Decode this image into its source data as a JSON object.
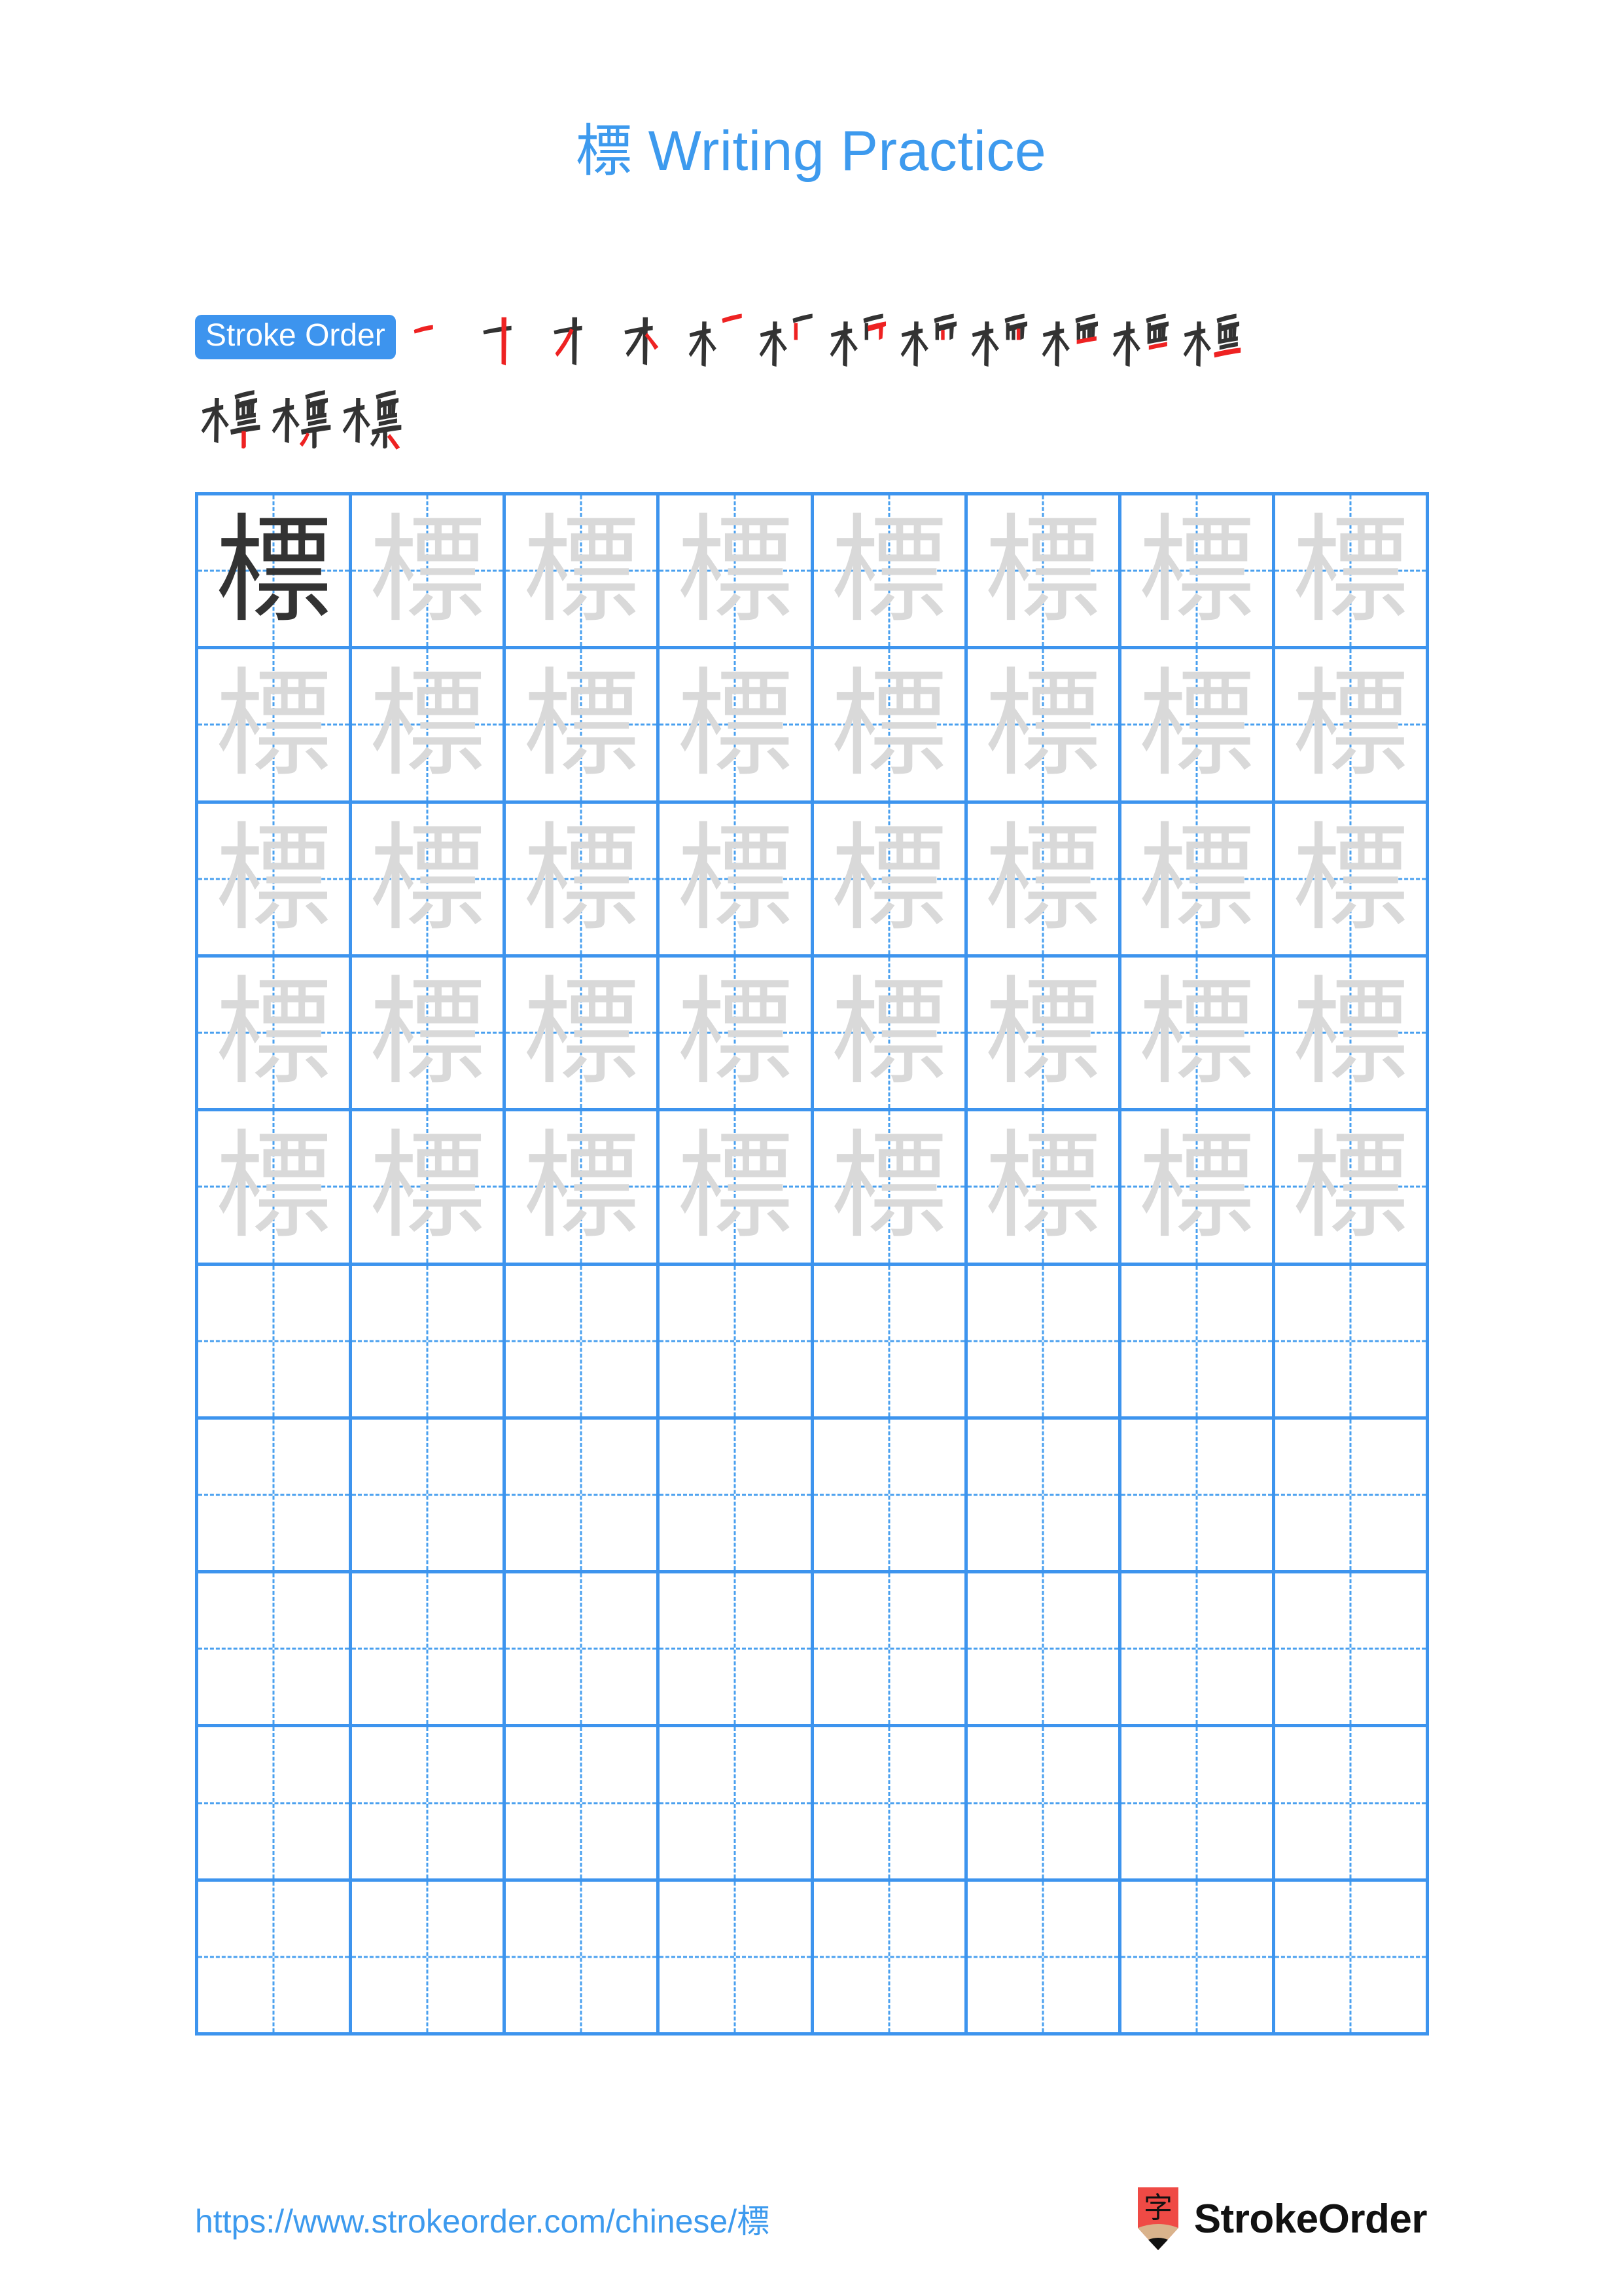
{
  "document": {
    "character": "標",
    "title_suffix": " Writing Practice",
    "title_full": "標 Writing Practice"
  },
  "colors": {
    "accent_blue": "#3d9aee",
    "badge_blue": "#3d94ee",
    "grid_line": "#3d94ee",
    "grid_dash": "#4aa0ef",
    "stroke_done": "#333333",
    "stroke_new": "#ee2222",
    "trace_gray": "#d9d9d9",
    "logo_red": "#ef4a45",
    "logo_wood": "#d9b38c"
  },
  "stroke_order": {
    "badge_label": "Stroke Order",
    "total_strokes": 15,
    "steps": [
      {
        "index": 1,
        "partial": "一"
      },
      {
        "index": 2,
        "partial": "十"
      },
      {
        "index": 3,
        "partial": "才"
      },
      {
        "index": 4,
        "partial": "木"
      },
      {
        "index": 5,
        "partial": "木 + 一"
      },
      {
        "index": 6,
        "partial": "木 + 丨一"
      },
      {
        "index": 7,
        "partial": "木 + 𠃍"
      },
      {
        "index": 8,
        "partial": "木 + 丅"
      },
      {
        "index": 9,
        "partial": "栖"
      },
      {
        "index": 10,
        "partial": "栖 + 一"
      },
      {
        "index": 11,
        "partial": "覀"
      },
      {
        "index": 12,
        "partial": "標 (12)"
      },
      {
        "index": 13,
        "partial": "標 (13)"
      },
      {
        "index": 14,
        "partial": "標 (14)"
      },
      {
        "index": 15,
        "partial": "標"
      }
    ],
    "line_breaks": [
      12,
      15
    ]
  },
  "practice_grid": {
    "columns": 8,
    "rows": 10,
    "filled_rows": 5,
    "empty_rows": 5,
    "solid_cells": 1,
    "cells": [
      {
        "row": 1,
        "col": 1,
        "char": "標",
        "style": "solid"
      },
      {
        "row": 1,
        "col": 2,
        "char": "標",
        "style": "trace"
      },
      {
        "row": 1,
        "col": 3,
        "char": "標",
        "style": "trace"
      },
      {
        "row": 1,
        "col": 4,
        "char": "標",
        "style": "trace"
      },
      {
        "row": 1,
        "col": 5,
        "char": "標",
        "style": "trace"
      },
      {
        "row": 1,
        "col": 6,
        "char": "標",
        "style": "trace"
      },
      {
        "row": 1,
        "col": 7,
        "char": "標",
        "style": "trace"
      },
      {
        "row": 1,
        "col": 8,
        "char": "標",
        "style": "trace"
      },
      {
        "row": 2,
        "col": 1,
        "char": "標",
        "style": "trace"
      },
      {
        "row": 2,
        "col": 2,
        "char": "標",
        "style": "trace"
      },
      {
        "row": 2,
        "col": 3,
        "char": "標",
        "style": "trace"
      },
      {
        "row": 2,
        "col": 4,
        "char": "標",
        "style": "trace"
      },
      {
        "row": 2,
        "col": 5,
        "char": "標",
        "style": "trace"
      },
      {
        "row": 2,
        "col": 6,
        "char": "標",
        "style": "trace"
      },
      {
        "row": 2,
        "col": 7,
        "char": "標",
        "style": "trace"
      },
      {
        "row": 2,
        "col": 8,
        "char": "標",
        "style": "trace"
      },
      {
        "row": 3,
        "col": 1,
        "char": "標",
        "style": "trace"
      },
      {
        "row": 3,
        "col": 2,
        "char": "標",
        "style": "trace"
      },
      {
        "row": 3,
        "col": 3,
        "char": "標",
        "style": "trace"
      },
      {
        "row": 3,
        "col": 4,
        "char": "標",
        "style": "trace"
      },
      {
        "row": 3,
        "col": 5,
        "char": "標",
        "style": "trace"
      },
      {
        "row": 3,
        "col": 6,
        "char": "標",
        "style": "trace"
      },
      {
        "row": 3,
        "col": 7,
        "char": "標",
        "style": "trace"
      },
      {
        "row": 3,
        "col": 8,
        "char": "標",
        "style": "trace"
      },
      {
        "row": 4,
        "col": 1,
        "char": "標",
        "style": "trace"
      },
      {
        "row": 4,
        "col": 2,
        "char": "標",
        "style": "trace"
      },
      {
        "row": 4,
        "col": 3,
        "char": "標",
        "style": "trace"
      },
      {
        "row": 4,
        "col": 4,
        "char": "標",
        "style": "trace"
      },
      {
        "row": 4,
        "col": 5,
        "char": "標",
        "style": "trace"
      },
      {
        "row": 4,
        "col": 6,
        "char": "標",
        "style": "trace"
      },
      {
        "row": 4,
        "col": 7,
        "char": "標",
        "style": "trace"
      },
      {
        "row": 4,
        "col": 8,
        "char": "標",
        "style": "trace"
      },
      {
        "row": 5,
        "col": 1,
        "char": "標",
        "style": "trace"
      },
      {
        "row": 5,
        "col": 2,
        "char": "標",
        "style": "trace"
      },
      {
        "row": 5,
        "col": 3,
        "char": "標",
        "style": "trace"
      },
      {
        "row": 5,
        "col": 4,
        "char": "標",
        "style": "trace"
      },
      {
        "row": 5,
        "col": 5,
        "char": "標",
        "style": "trace"
      },
      {
        "row": 5,
        "col": 6,
        "char": "標",
        "style": "trace"
      },
      {
        "row": 5,
        "col": 7,
        "char": "標",
        "style": "trace"
      },
      {
        "row": 5,
        "col": 8,
        "char": "標",
        "style": "trace"
      },
      {
        "row": 6,
        "col": 1,
        "char": "",
        "style": "empty"
      },
      {
        "row": 6,
        "col": 2,
        "char": "",
        "style": "empty"
      },
      {
        "row": 6,
        "col": 3,
        "char": "",
        "style": "empty"
      },
      {
        "row": 6,
        "col": 4,
        "char": "",
        "style": "empty"
      },
      {
        "row": 6,
        "col": 5,
        "char": "",
        "style": "empty"
      },
      {
        "row": 6,
        "col": 6,
        "char": "",
        "style": "empty"
      },
      {
        "row": 6,
        "col": 7,
        "char": "",
        "style": "empty"
      },
      {
        "row": 6,
        "col": 8,
        "char": "",
        "style": "empty"
      },
      {
        "row": 7,
        "col": 1,
        "char": "",
        "style": "empty"
      },
      {
        "row": 7,
        "col": 2,
        "char": "",
        "style": "empty"
      },
      {
        "row": 7,
        "col": 3,
        "char": "",
        "style": "empty"
      },
      {
        "row": 7,
        "col": 4,
        "char": "",
        "style": "empty"
      },
      {
        "row": 7,
        "col": 5,
        "char": "",
        "style": "empty"
      },
      {
        "row": 7,
        "col": 6,
        "char": "",
        "style": "empty"
      },
      {
        "row": 7,
        "col": 7,
        "char": "",
        "style": "empty"
      },
      {
        "row": 7,
        "col": 8,
        "char": "",
        "style": "empty"
      },
      {
        "row": 8,
        "col": 1,
        "char": "",
        "style": "empty"
      },
      {
        "row": 8,
        "col": 2,
        "char": "",
        "style": "empty"
      },
      {
        "row": 8,
        "col": 3,
        "char": "",
        "style": "empty"
      },
      {
        "row": 8,
        "col": 4,
        "char": "",
        "style": "empty"
      },
      {
        "row": 8,
        "col": 5,
        "char": "",
        "style": "empty"
      },
      {
        "row": 8,
        "col": 6,
        "char": "",
        "style": "empty"
      },
      {
        "row": 8,
        "col": 7,
        "char": "",
        "style": "empty"
      },
      {
        "row": 8,
        "col": 8,
        "char": "",
        "style": "empty"
      },
      {
        "row": 9,
        "col": 1,
        "char": "",
        "style": "empty"
      },
      {
        "row": 9,
        "col": 2,
        "char": "",
        "style": "empty"
      },
      {
        "row": 9,
        "col": 3,
        "char": "",
        "style": "empty"
      },
      {
        "row": 9,
        "col": 4,
        "char": "",
        "style": "empty"
      },
      {
        "row": 9,
        "col": 5,
        "char": "",
        "style": "empty"
      },
      {
        "row": 9,
        "col": 6,
        "char": "",
        "style": "empty"
      },
      {
        "row": 9,
        "col": 7,
        "char": "",
        "style": "empty"
      },
      {
        "row": 9,
        "col": 8,
        "char": "",
        "style": "empty"
      },
      {
        "row": 10,
        "col": 1,
        "char": "",
        "style": "empty"
      },
      {
        "row": 10,
        "col": 2,
        "char": "",
        "style": "empty"
      },
      {
        "row": 10,
        "col": 3,
        "char": "",
        "style": "empty"
      },
      {
        "row": 10,
        "col": 4,
        "char": "",
        "style": "empty"
      },
      {
        "row": 10,
        "col": 5,
        "char": "",
        "style": "empty"
      },
      {
        "row": 10,
        "col": 6,
        "char": "",
        "style": "empty"
      },
      {
        "row": 10,
        "col": 7,
        "char": "",
        "style": "empty"
      },
      {
        "row": 10,
        "col": 8,
        "char": "",
        "style": "empty"
      }
    ]
  },
  "footer": {
    "url": "https://www.strokeorder.com/chinese/標",
    "brand_name": "StrokeOrder",
    "logo_char": "字"
  }
}
